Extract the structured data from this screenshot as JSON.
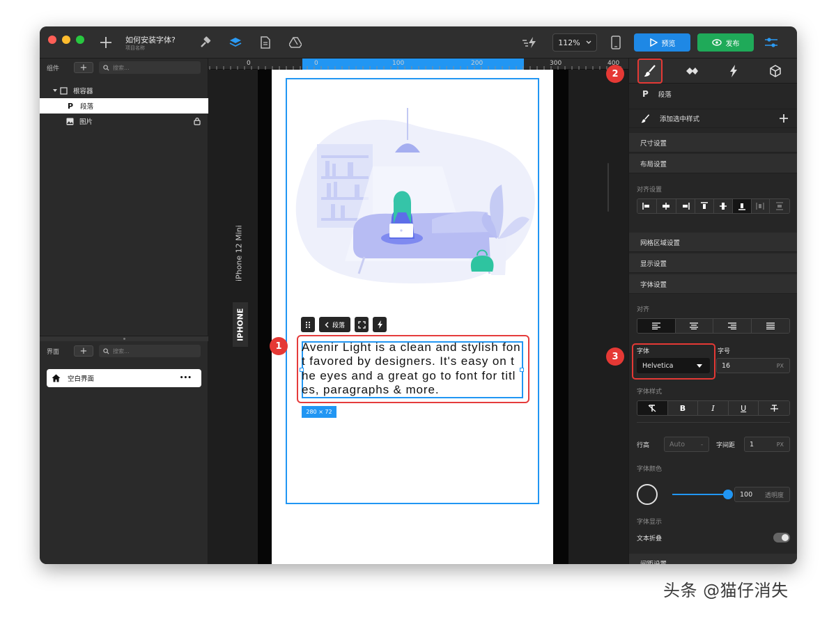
{
  "header": {
    "project_title": "如何安装字体?",
    "project_subtitle": "项目名称",
    "zoom": "112%",
    "preview_label": "预览",
    "publish_label": "发布"
  },
  "components_panel": {
    "title": "组件",
    "search_placeholder": "搜索...",
    "tree": {
      "root": "根容器",
      "paragraph": "段落",
      "image": "图片"
    }
  },
  "screens_panel": {
    "title": "界面",
    "search_placeholder": "搜索...",
    "screen_item": "空白界面",
    "more": "•••"
  },
  "canvas": {
    "ruler_labels": [
      "0",
      "0",
      "100",
      "200",
      "300",
      "400"
    ],
    "device_name": "iPhone 12 Mini",
    "device_type": "IPHONE",
    "mini_toolbar_label": "段落",
    "paragraph_text": "Avenir Light is a clean and stylish font favored by designers. It's easy on the eyes and a great go to font for titles, paragraphs & more.",
    "size_tag": "280 × 72"
  },
  "badges": [
    "1",
    "2",
    "3"
  ],
  "inspector": {
    "element_type": "段落",
    "add_style": "添加选中样式",
    "sections": {
      "size": "尺寸设置",
      "layout": "布局设置",
      "align_settings": "对齐设置",
      "grid": "网格区域设置",
      "display": "显示设置",
      "font": "字体设置"
    },
    "text_align_label": "对齐",
    "font_family_label": "字体",
    "font_family_value": "Helvetica",
    "font_size_label": "字号",
    "font_size_value": "16",
    "font_size_unit": "PX",
    "font_style_label": "字体样式",
    "line_height_label": "行高",
    "line_height_value": "Auto",
    "line_height_unit": "-",
    "letter_spacing_label": "字间距",
    "letter_spacing_value": "1",
    "letter_spacing_unit": "PX",
    "font_color_label": "字体颜色",
    "opacity_value": "100",
    "opacity_label": "透明度",
    "opacity_level": 1.0,
    "font_display_label": "字体显示",
    "wrap_label": "文本折叠",
    "wrap_enabled": false,
    "spacing_label": "间距设置"
  },
  "watermark": "头条 @猫仔消失",
  "colors": {
    "accent_blue": "#2196f3",
    "preview_button": "#1e88e5",
    "publish_button": "#1faa59",
    "highlight_red": "#e53935"
  }
}
